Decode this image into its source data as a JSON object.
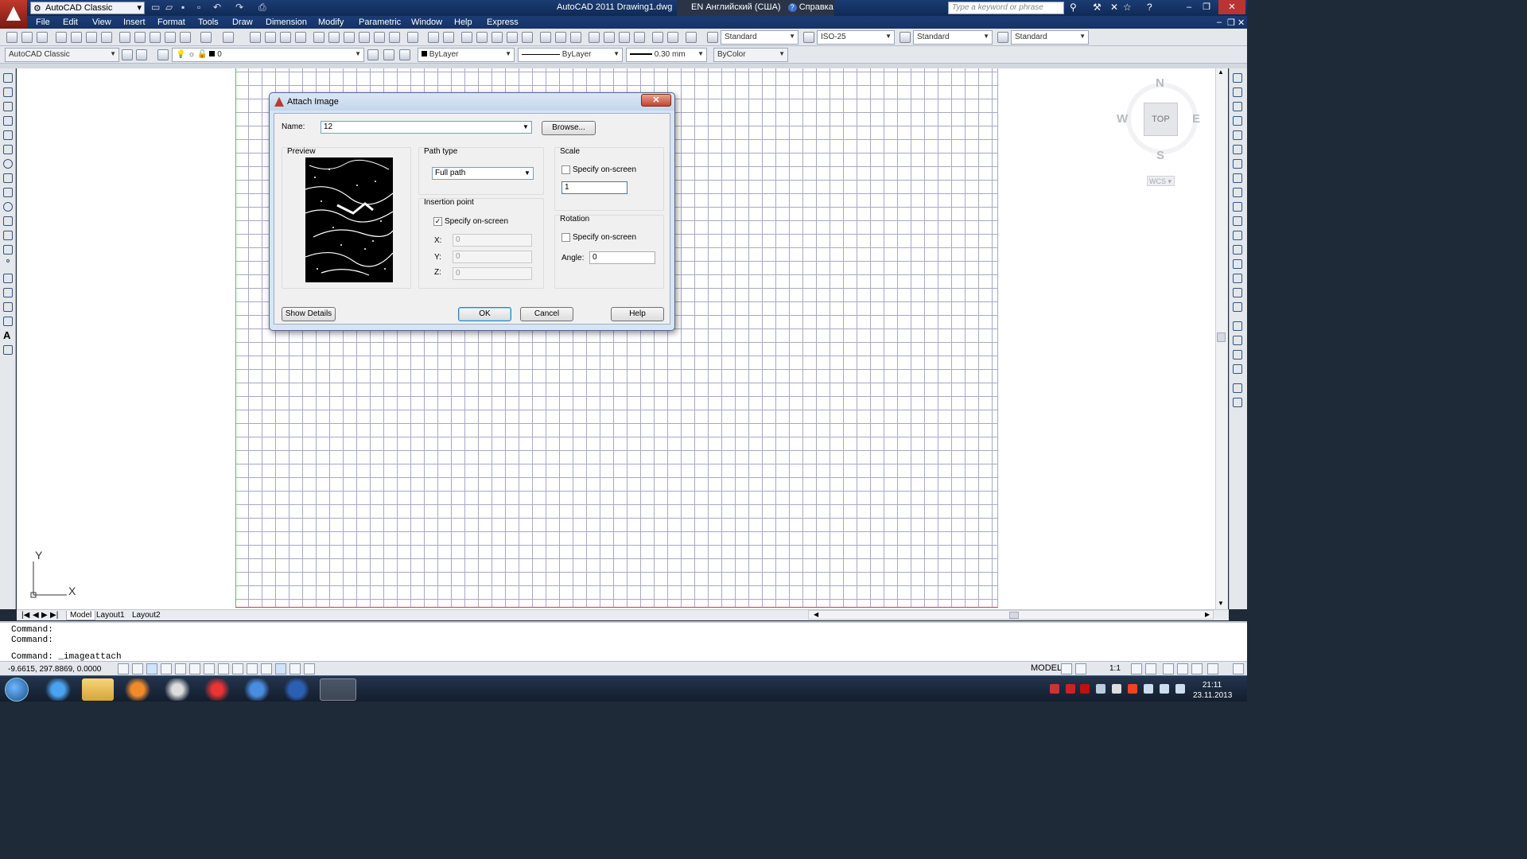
{
  "titlebar": {
    "workspace": "AutoCAD Classic",
    "app_title": "AutoCAD 2011    Drawing1.dwg",
    "language": "EN Английский (США)",
    "help": "Справка",
    "search_placeholder": "Type a keyword or phrase"
  },
  "menu": [
    "File",
    "Edit",
    "View",
    "Insert",
    "Format",
    "Tools",
    "Draw",
    "Dimension",
    "Modify",
    "Parametric",
    "Window",
    "Help",
    "Express"
  ],
  "toolbar1": {
    "text_style": "Standard",
    "dim_style": "ISO-25",
    "table_style": "Standard",
    "mleader_style": "Standard"
  },
  "toolbar2": {
    "workspace": "AutoCAD Classic",
    "layer": "0",
    "color": "ByLayer",
    "linetype": "ByLayer",
    "lineweight": "0.30 mm",
    "plotstyle": "ByColor"
  },
  "viewcube": {
    "n": "N",
    "s": "S",
    "e": "E",
    "w": "W",
    "top": "TOP",
    "wcs": "WCS"
  },
  "ucs": {
    "x": "X",
    "y": "Y"
  },
  "tabs": [
    "Model",
    "Layout1",
    "Layout2"
  ],
  "command": {
    "line1": "Command:",
    "line2": "Command:",
    "line3": "Command:  _imageattach"
  },
  "status": {
    "coords": "-9.6615,  297.8869, 0.0000",
    "model": "MODEL",
    "scale": "1:1"
  },
  "clock": {
    "time": "21:11",
    "date": "23.11.2013"
  },
  "dialog": {
    "title": "Attach Image",
    "name_label": "Name:",
    "name_value": "12",
    "browse": "Browse...",
    "preview_label": "Preview",
    "path_type_label": "Path type",
    "path_type_value": "Full path",
    "insertion_label": "Insertion point",
    "insertion_specify": "Specify on-screen",
    "insertion_checked": true,
    "x_label": "X:",
    "y_label": "Y:",
    "z_label": "Z:",
    "x_value": "0",
    "y_value": "0",
    "z_value": "0",
    "scale_label": "Scale",
    "scale_specify": "Specify on-screen",
    "scale_value": "1",
    "rotation_label": "Rotation",
    "rotation_specify": "Specify on-screen",
    "angle_label": "Angle:",
    "angle_value": "0",
    "show_details": "Show Details",
    "ok": "OK",
    "cancel": "Cancel",
    "help": "Help"
  }
}
